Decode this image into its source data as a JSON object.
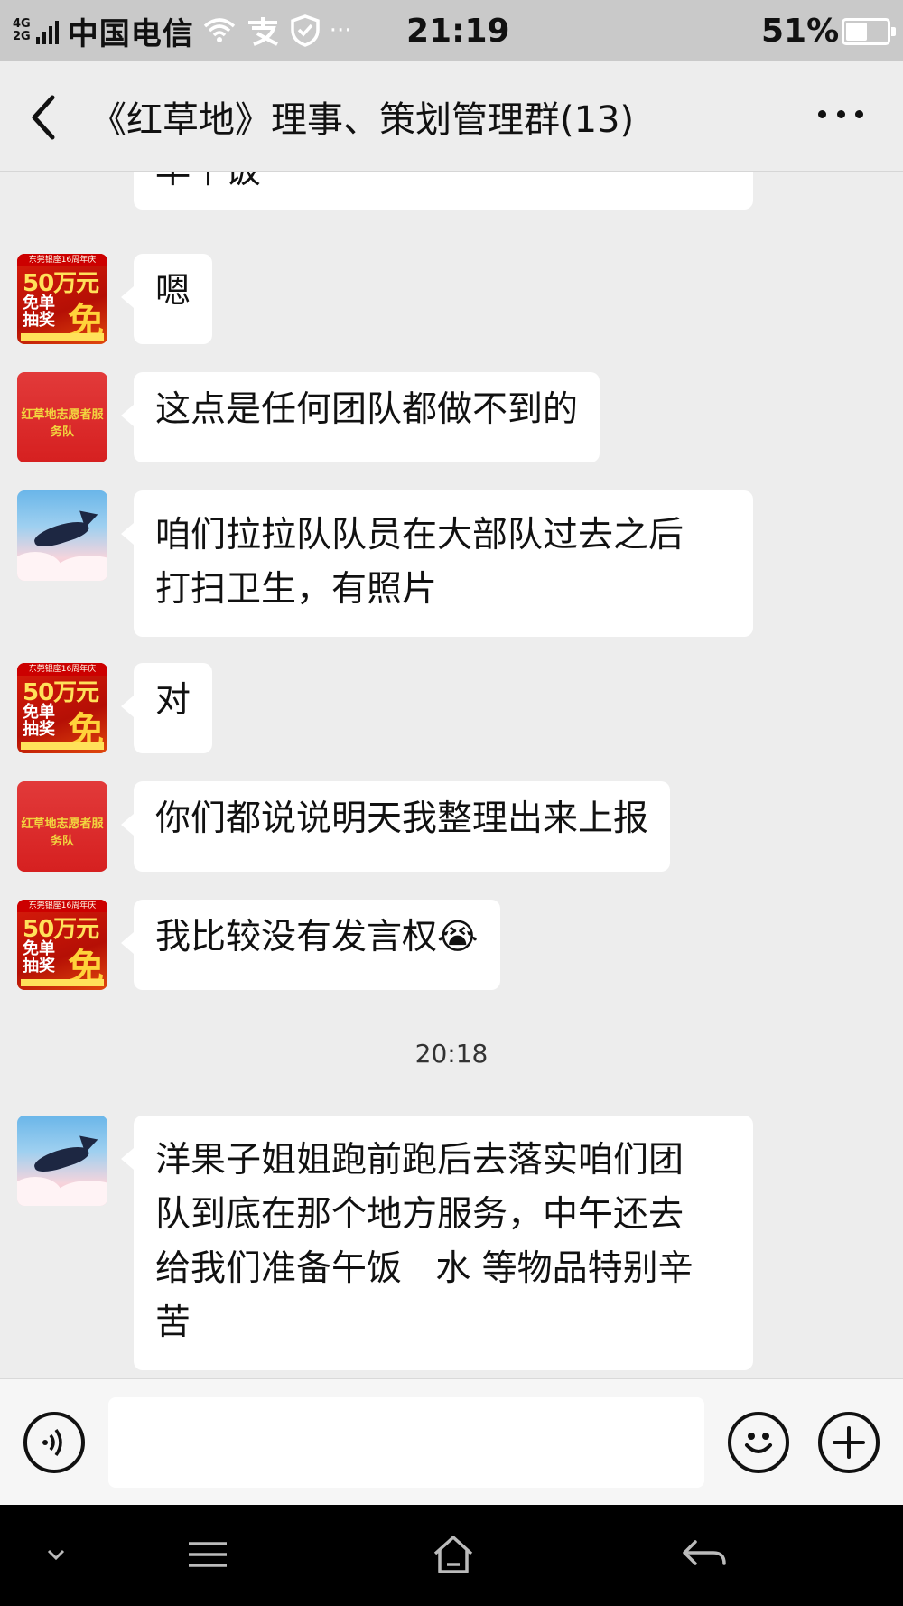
{
  "status_bar": {
    "network_top": "4G",
    "network_bottom": "2G",
    "carrier": "中国电信",
    "more": "···",
    "time": "21:19",
    "battery": "51%",
    "battery_level": 0.51
  },
  "header": {
    "title": "《红草地》理事、策划管理群(13)"
  },
  "avatars": {
    "lottery": {
      "top_text": "东莞银座16周年庆",
      "big": "50万元",
      "line1": "免单",
      "line2": "抽奖",
      "char": "免"
    },
    "banner": {
      "text": "红草地志愿者服务队"
    }
  },
  "messages": [
    {
      "sender": "unknown",
      "text": "早午饭"
    },
    {
      "sender": "lottery",
      "text": "嗯"
    },
    {
      "sender": "banner",
      "text": "这点是任何团队都做不到的"
    },
    {
      "sender": "whale",
      "lines": [
        "咱们拉拉队队员在大部队过去之后",
        "打扫卫生，有照片"
      ]
    },
    {
      "sender": "lottery",
      "text": "对"
    },
    {
      "sender": "banner",
      "text": "你们都说说明天我整理出来上报"
    },
    {
      "sender": "lottery",
      "text": "我比较没有发言权",
      "emoji": "😭"
    },
    {
      "sender": "whale",
      "lines": [
        "洋果子姐姐跑前跑后去落实咱们团",
        "队到底在那个地方服务，中午还去",
        "给我们准备午饭   水 等物品特别辛",
        "苦"
      ]
    }
  ],
  "timestamp": "20:18",
  "input": {
    "value": ""
  },
  "icons": [
    "back-icon",
    "more-icon",
    "voice-icon",
    "emoji-icon",
    "plus-icon",
    "nav-down-icon",
    "nav-menu-icon",
    "nav-home-icon",
    "nav-back-icon"
  ]
}
